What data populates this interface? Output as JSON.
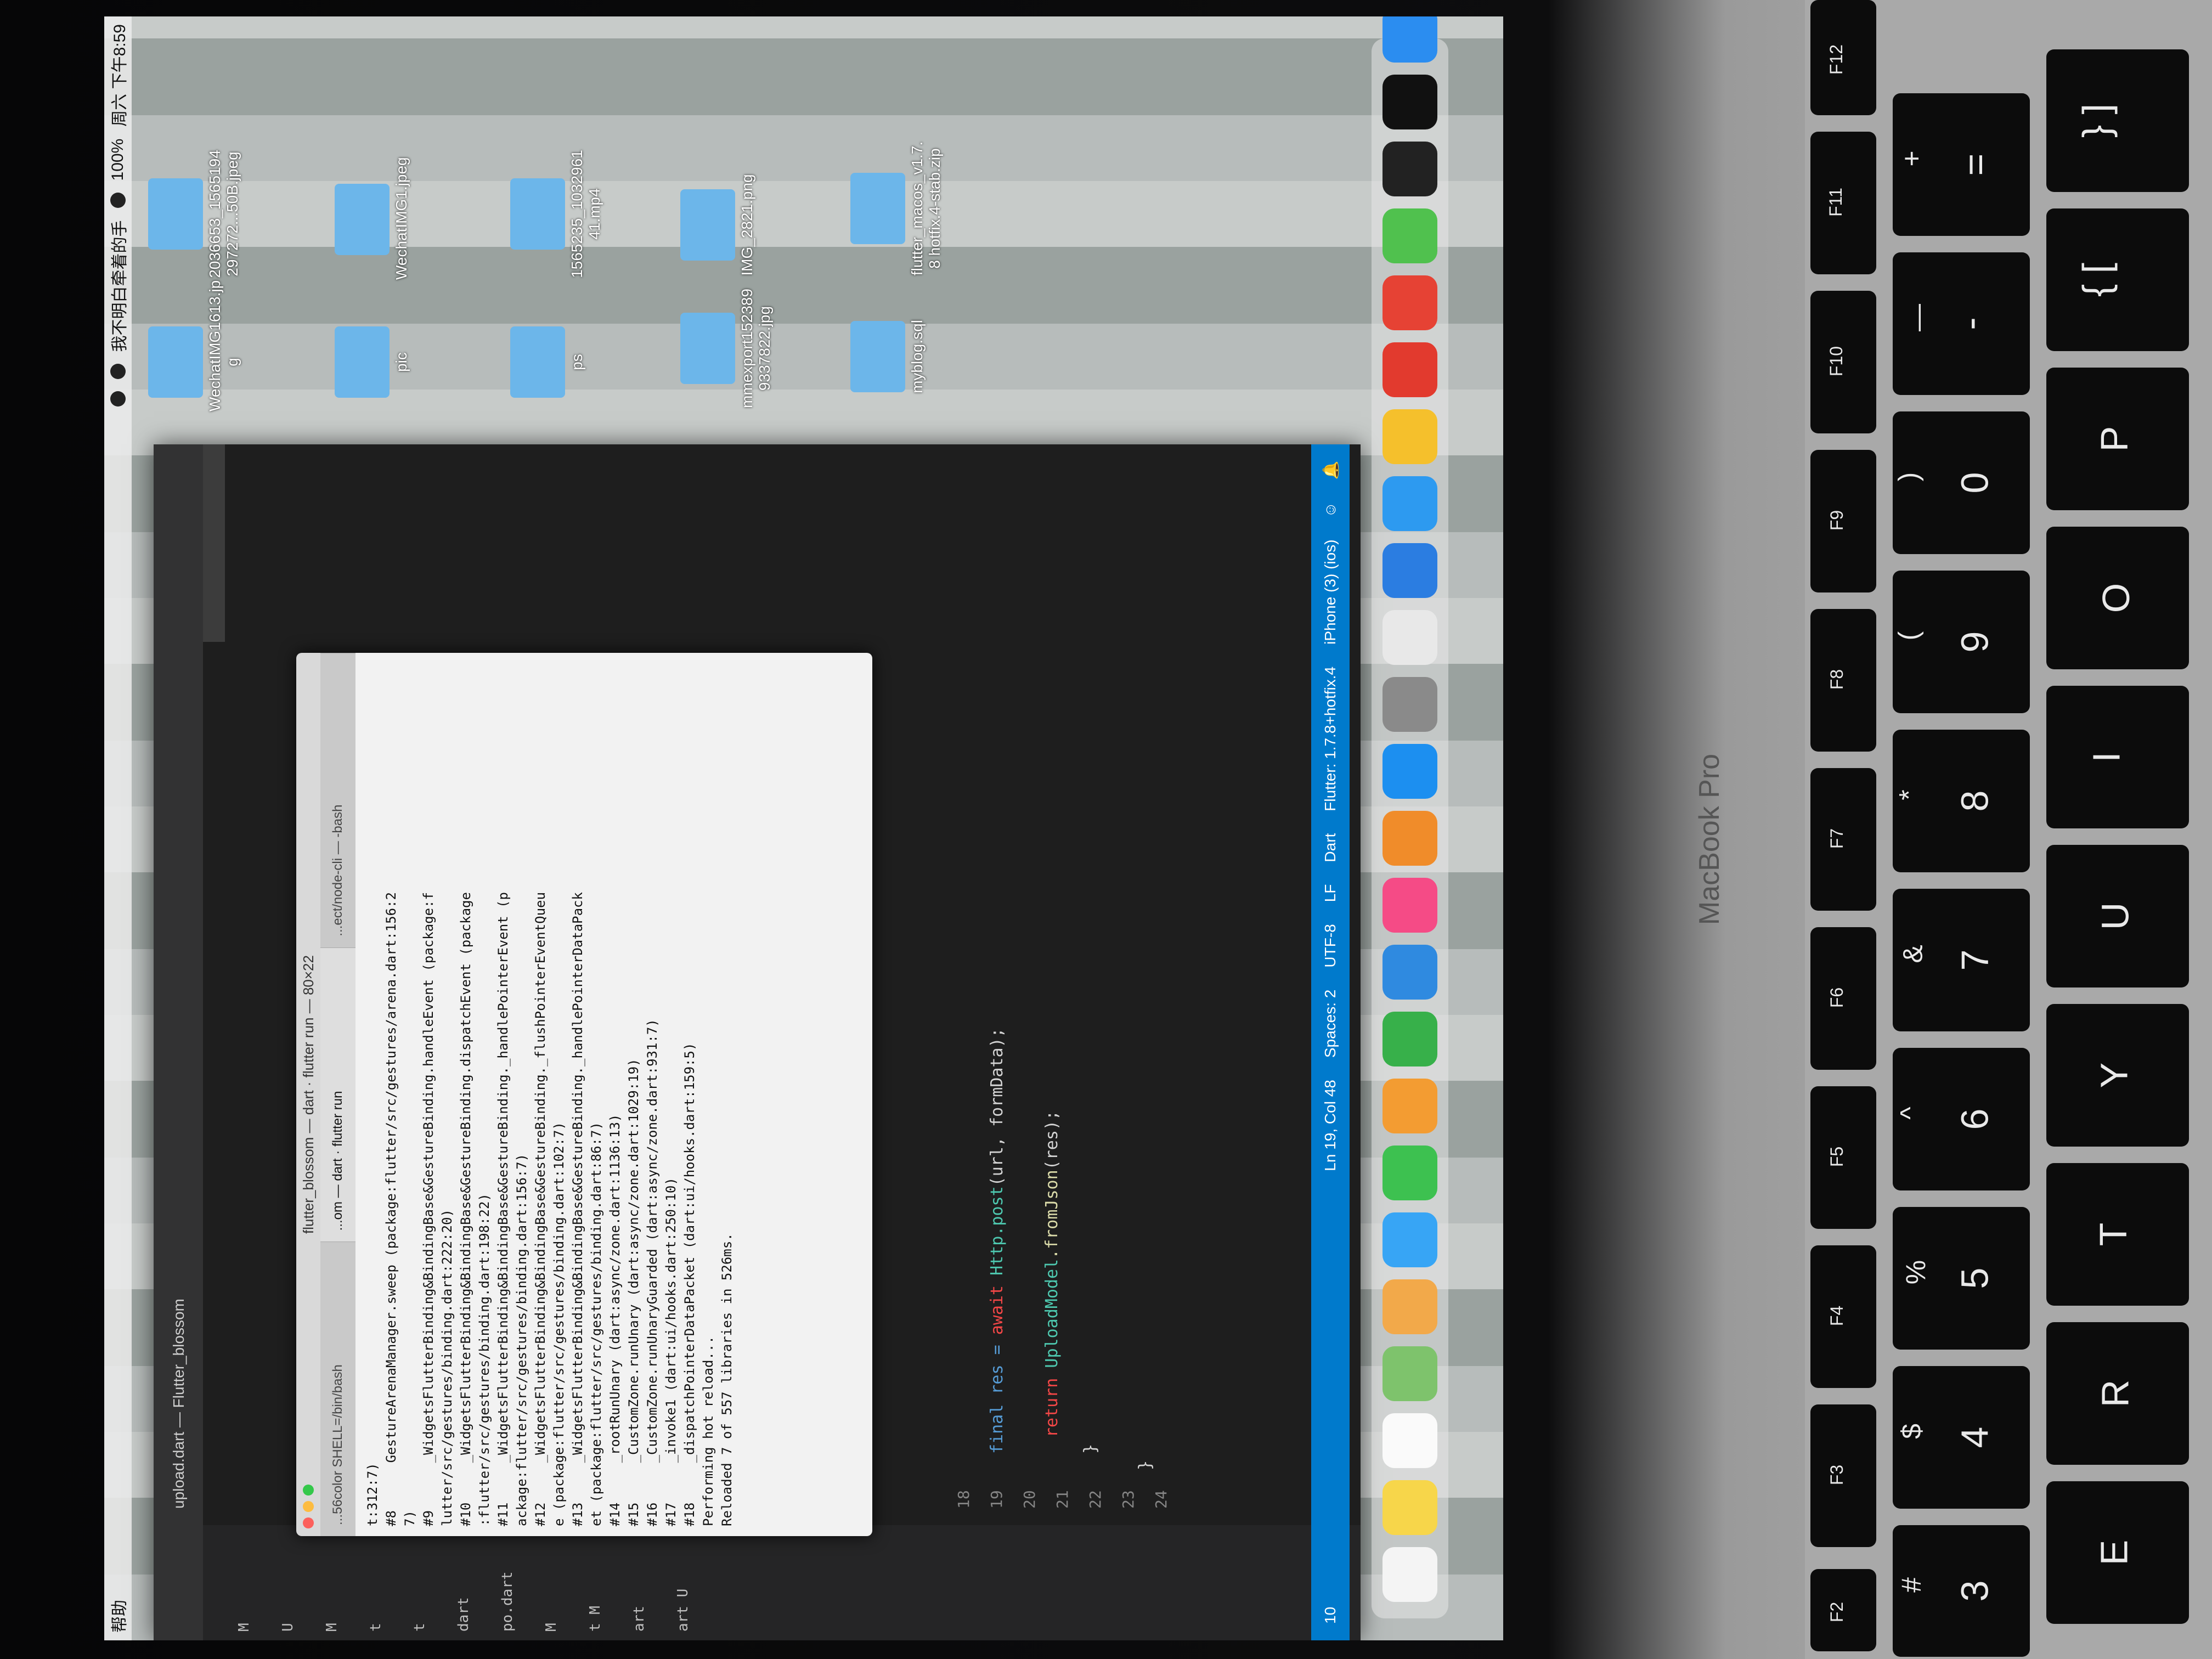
{
  "menubar": {
    "help": "帮助",
    "song": "我不明白牵着的手",
    "battery": "100%",
    "clock": "周六 下午8:59"
  },
  "vscode": {
    "title": "upload.dart — Flutter_blossom",
    "sidebar_items": [
      {
        "label": "M"
      },
      {
        "label": "U"
      },
      {
        "label": "M"
      },
      {
        "label": "t"
      },
      {
        "label": "t"
      },
      {
        "label": "dart"
      },
      {
        "label": "po.dart"
      },
      {
        "label": "M"
      },
      {
        "label": "t M"
      },
      {
        "label": "art"
      },
      {
        "label": "art U"
      }
    ],
    "line_numbers": [
      "18",
      "19",
      "20",
      "21",
      "22",
      "23",
      "24"
    ],
    "code": {
      "line19_a": "final res = ",
      "line19_b": "await ",
      "line19_c": "Http.post",
      "line19_d": "(url, formData);",
      "line20_a": "return ",
      "line20_b": "UploadModel",
      "line20_c": ".fromJson",
      "line20_d": "(res);",
      "line21": "}",
      "line23": "}"
    },
    "status": {
      "errors": "10",
      "position": "Ln 19, Col 48",
      "spaces": "Spaces: 2",
      "encoding": "UTF-8",
      "eol": "LF",
      "language": "Dart",
      "flutter": "Flutter: 1.7.8+hotfix.4",
      "device": "iPhone (3) (ios)"
    }
  },
  "terminal": {
    "title": "flutter_blossom — dart · flutter run — 80×22",
    "tabs": [
      "...56color SHELL=/bin/bash",
      "...om — dart · flutter run",
      "...ect/node-cli — -bash"
    ],
    "lines": [
      "t:312:7)",
      "#8      GestureArenaManager.sweep (package:flutter/src/gestures/arena.dart:156:2",
      "7)",
      "#9      _WidgetsFlutterBinding&BindingBase&GestureBinding.handleEvent (package:f",
      "lutter/src/gestures/binding.dart:222:20)",
      "#10     _WidgetsFlutterBinding&BindingBase&GestureBinding.dispatchEvent (package",
      ":flutter/src/gestures/binding.dart:198:22)",
      "#11     _WidgetsFlutterBinding&BindingBase&GestureBinding._handlePointerEvent (p",
      "ackage:flutter/src/gestures/binding.dart:156:7)",
      "#12     _WidgetsFlutterBinding&BindingBase&GestureBinding._flushPointerEventQueu",
      "e (package:flutter/src/gestures/binding.dart:102:7)",
      "#13     _WidgetsFlutterBinding&BindingBase&GestureBinding._handlePointerDataPack",
      "et (package:flutter/src/gestures/binding.dart:86:7)",
      "#14     _rootRunUnary (dart:async/zone.dart:1136:13)",
      "#15     _CustomZone.runUnary (dart:async/zone.dart:1029:19)",
      "#16     _CustomZone.runUnaryGuarded (dart:async/zone.dart:931:7)",
      "#17     _invoke1 (dart:ui/hooks.dart:250:10)",
      "#18     _dispatchPointerDataPacket (dart:ui/hooks.dart:159:5)",
      "",
      "Performing hot reload...",
      "Reloaded 7 of 557 libraries in 526ms."
    ]
  },
  "desktop_files": [
    {
      "name": "WechatIMG1613.jp g"
    },
    {
      "name": "2036653_1565194 297272...50B.jpeg"
    },
    {
      "name": "pic"
    },
    {
      "name": "WechatIMG1.jpeg"
    },
    {
      "name": "ps"
    },
    {
      "name": "1565235_1032961 41.mp4"
    },
    {
      "name": "mmexport152389 9337822.jpg"
    },
    {
      "name": "IMG_2821.png"
    },
    {
      "name": "myblog.sql"
    },
    {
      "name": "flutter_macos_v1.7. 8 hotfix.4-stab.zip"
    }
  ],
  "dock_apps": [
    "calendar",
    "notes",
    "reminders",
    "maps",
    "photos",
    "messages",
    "facetime",
    "pages",
    "numbers",
    "keynote",
    "itunes",
    "books",
    "app-store",
    "system-preferences",
    "chrome",
    "rocket",
    "qq-browser",
    "vscode",
    "netease-music",
    "wechat",
    "qq",
    "terminal",
    "dingtalk",
    "iqiyi"
  ],
  "keyboard": {
    "brand": "MacBook Pro",
    "fkeys": [
      "F2",
      "F3",
      "F4",
      "F5",
      "F6",
      "F7",
      "F8",
      "F9",
      "F10",
      "F11",
      "F12"
    ],
    "number_row": [
      "3",
      "4",
      "5",
      "6",
      "7",
      "8",
      "9",
      "0",
      "-",
      "="
    ],
    "number_row_upper": [
      "#",
      "$",
      "%",
      "^",
      "&",
      "*",
      "(",
      ")",
      "—",
      "+"
    ],
    "letter_row": [
      "E",
      "R",
      "T",
      "Y",
      "U",
      "I",
      "O",
      "P",
      "{ [",
      "} ]"
    ]
  },
  "colors": {
    "statusbar": "#007acc",
    "editor_bg": "#1e1e1e",
    "folder": "#6cb6ea"
  }
}
